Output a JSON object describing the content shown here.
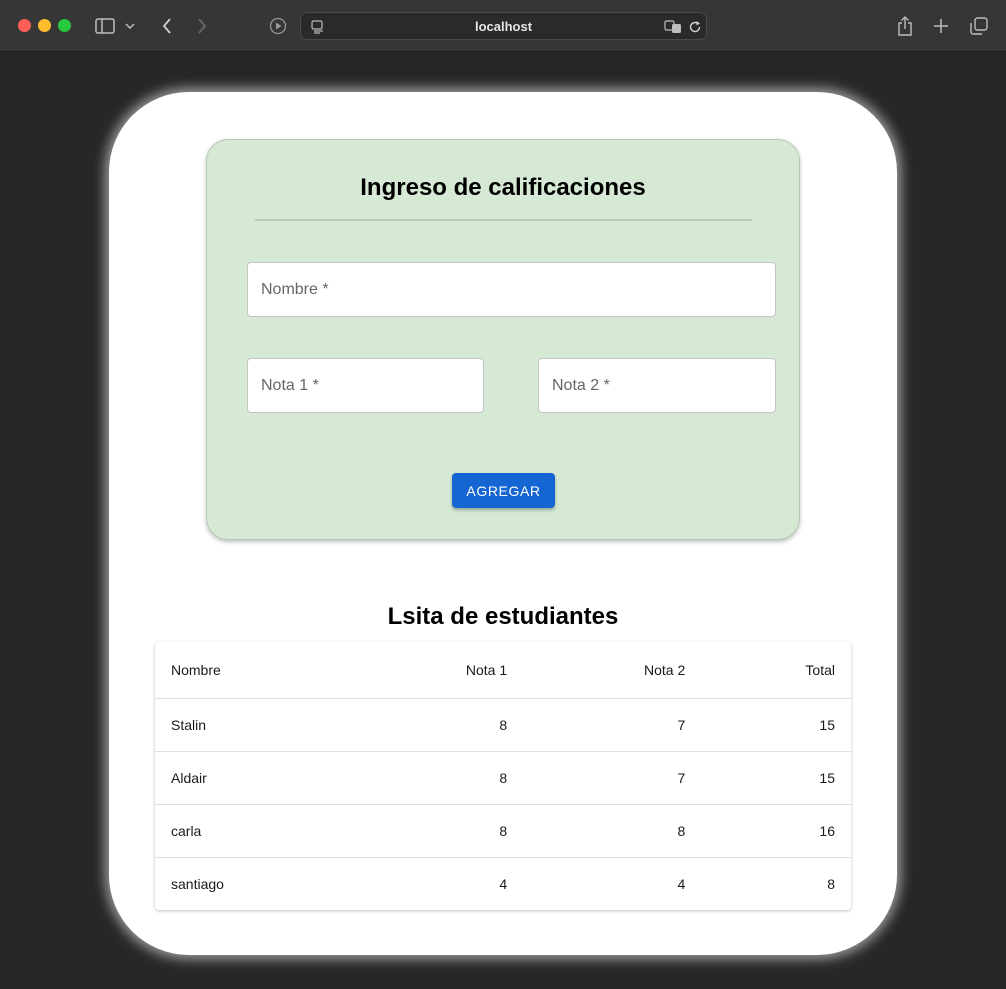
{
  "browser": {
    "url": "localhost"
  },
  "form": {
    "title": "Ingreso de calificaciones",
    "fields": {
      "nombre_placeholder": "Nombre *",
      "nota1_placeholder": "Nota 1 *",
      "nota2_placeholder": "Nota 2 *"
    },
    "submit_label": "AGREGAR"
  },
  "list": {
    "title": "Lsita de estudiantes",
    "columns": [
      "Nombre",
      "Nota 1",
      "Nota 2",
      "Total"
    ],
    "rows": [
      [
        "Stalin",
        "8",
        "7",
        "15"
      ],
      [
        "Aldair",
        "8",
        "7",
        "15"
      ],
      [
        "carla",
        "8",
        "8",
        "16"
      ],
      [
        "santiago",
        "4",
        "4",
        "8"
      ]
    ]
  },
  "colors": {
    "form_background": "#d5e9d5",
    "button": "#1565d2"
  }
}
